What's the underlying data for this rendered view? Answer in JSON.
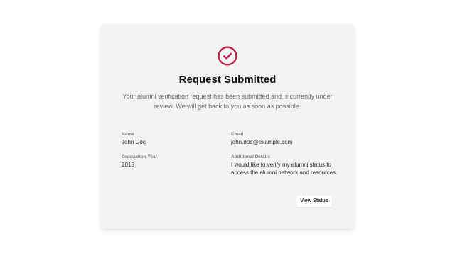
{
  "card": {
    "title": "Request Submitted",
    "message": "Your alumni verification request has been submitted and is currently under review. We will get back to you as soon as possible.",
    "icon": "check-circle-icon",
    "accent_color": "#c2214d"
  },
  "fields": {
    "name": {
      "label": "Name",
      "value": "John Doe"
    },
    "email": {
      "label": "Email",
      "value": "john.doe@example.com"
    },
    "graduation_year": {
      "label": "Graduation Year",
      "value": "2015"
    },
    "additional_details": {
      "label": "Additional Details",
      "value": "I would like to verify my alumni status to access the alumni network and resources."
    }
  },
  "actions": {
    "view_status_label": "View Status"
  }
}
